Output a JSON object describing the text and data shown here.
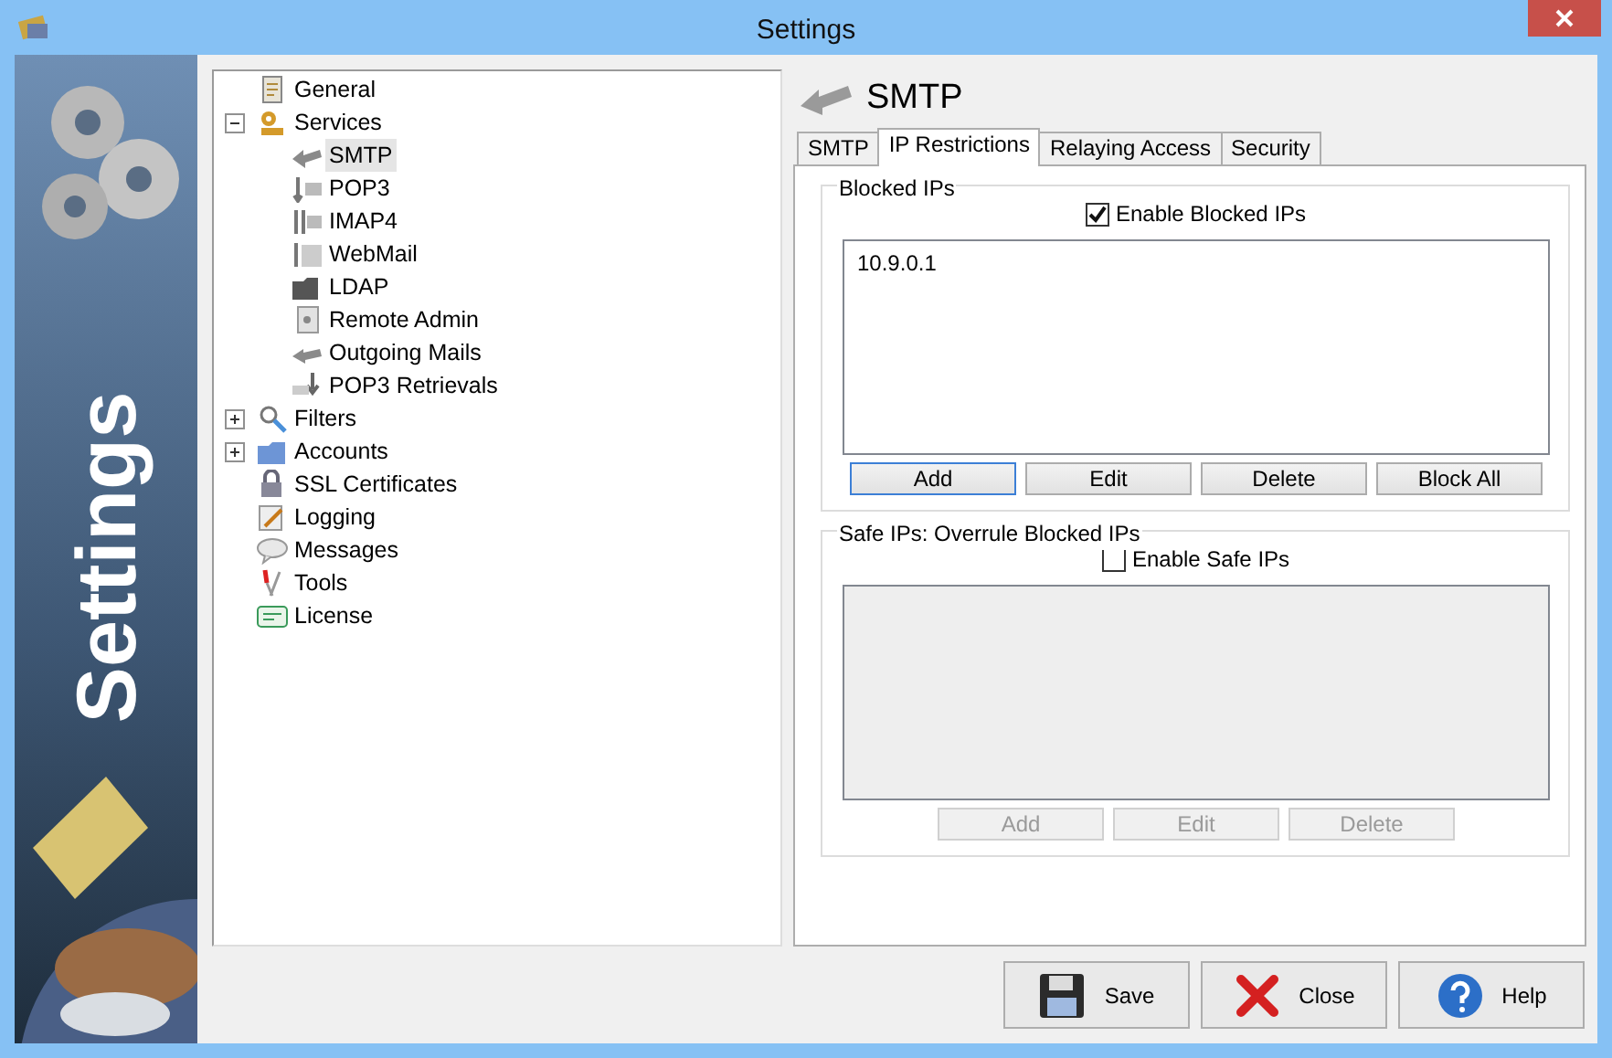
{
  "window": {
    "title": "Settings"
  },
  "banner": {
    "title": "Settings"
  },
  "tree": [
    {
      "label": "General",
      "selected": false
    },
    {
      "label": "Services",
      "selected": false,
      "expanded": true,
      "children": [
        {
          "label": "SMTP",
          "selected": true
        },
        {
          "label": "POP3",
          "selected": false
        },
        {
          "label": "IMAP4",
          "selected": false
        },
        {
          "label": "WebMail",
          "selected": false
        },
        {
          "label": "LDAP",
          "selected": false
        },
        {
          "label": "Remote Admin",
          "selected": false
        },
        {
          "label": "Outgoing Mails",
          "selected": false
        },
        {
          "label": "POP3 Retrievals",
          "selected": false
        }
      ]
    },
    {
      "label": "Filters",
      "selected": false,
      "expanded": false
    },
    {
      "label": "Accounts",
      "selected": false,
      "expanded": false
    },
    {
      "label": "SSL Certificates",
      "selected": false
    },
    {
      "label": "Logging",
      "selected": false
    },
    {
      "label": "Messages",
      "selected": false
    },
    {
      "label": "Tools",
      "selected": false
    },
    {
      "label": "License",
      "selected": false
    }
  ],
  "page": {
    "title": "SMTP"
  },
  "tabs": [
    {
      "label": "SMTP",
      "selected": false
    },
    {
      "label": "IP Restrictions",
      "selected": true
    },
    {
      "label": "Relaying Access",
      "selected": false
    },
    {
      "label": "Security",
      "selected": false
    }
  ],
  "groups": [
    {
      "legend": "Blocked IPs",
      "checkbox": {
        "label": "Enable Blocked IPs",
        "checked": true
      },
      "list": {
        "disabled": false,
        "entries": [
          "10.9.0.1"
        ]
      },
      "buttons": [
        {
          "label": "Add",
          "disabled": false,
          "focused": true
        },
        {
          "label": "Edit",
          "disabled": false,
          "focused": false
        },
        {
          "label": "Delete",
          "disabled": false,
          "focused": false
        },
        {
          "label": "Block All",
          "disabled": false,
          "focused": false
        }
      ]
    },
    {
      "legend": "Safe IPs: Overrule Blocked IPs",
      "checkbox": {
        "label": "Enable Safe IPs",
        "checked": false
      },
      "list": {
        "disabled": true
      },
      "buttons": [
        {
          "label": "Add",
          "disabled": true,
          "focused": false
        },
        {
          "label": "Edit",
          "disabled": true,
          "focused": false
        },
        {
          "label": "Delete",
          "disabled": true,
          "focused": false
        }
      ]
    }
  ],
  "footer_buttons": [
    {
      "label": "Save",
      "kind": "save"
    },
    {
      "label": "Close",
      "kind": "close"
    },
    {
      "label": "Help",
      "kind": "help"
    }
  ]
}
